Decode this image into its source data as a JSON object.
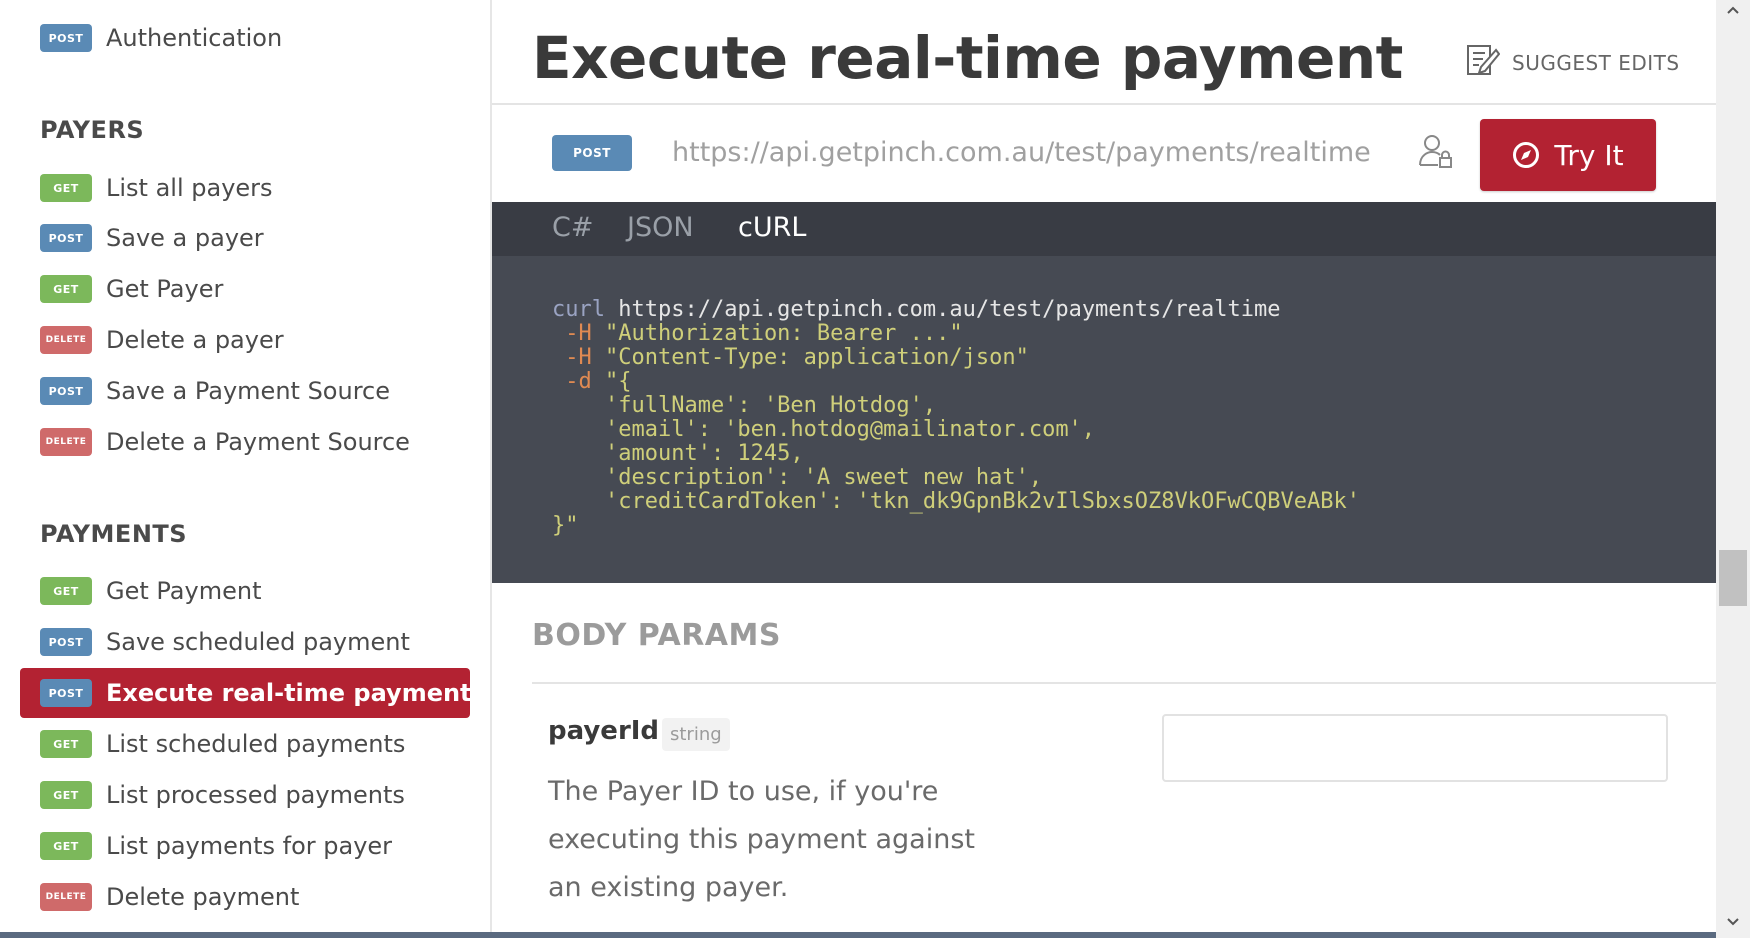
{
  "sidebar": {
    "auth_item": {
      "method": "POST",
      "label": "Authentication"
    },
    "sections": [
      {
        "title": "PAYERS",
        "items": [
          {
            "method": "GET",
            "label": "List all payers"
          },
          {
            "method": "POST",
            "label": "Save a payer"
          },
          {
            "method": "GET",
            "label": "Get Payer"
          },
          {
            "method": "DELETE",
            "label": "Delete a payer"
          },
          {
            "method": "POST",
            "label": "Save a Payment Source"
          },
          {
            "method": "DELETE",
            "label": "Delete a Payment Source"
          }
        ]
      },
      {
        "title": "PAYMENTS",
        "items": [
          {
            "method": "GET",
            "label": "Get Payment"
          },
          {
            "method": "POST",
            "label": "Save scheduled payment"
          },
          {
            "method": "POST",
            "label": "Execute real-time payment",
            "active": true
          },
          {
            "method": "GET",
            "label": "List scheduled payments"
          },
          {
            "method": "GET",
            "label": "List processed payments"
          },
          {
            "method": "GET",
            "label": "List payments for payer"
          },
          {
            "method": "DELETE",
            "label": "Delete payment"
          }
        ]
      }
    ]
  },
  "main": {
    "title": "Execute real-time payment",
    "suggest_edits": "SUGGEST EDITS",
    "endpoint": {
      "method": "POST",
      "url": "https://api.getpinch.com.au/test/payments/realtime",
      "try_it": "Try It"
    },
    "code_tabs": [
      "C#",
      "JSON",
      "cURL"
    ],
    "active_code_tab": "cURL",
    "code": {
      "cmd": "curl",
      "url": "https://api.getpinch.com.au/test/payments/realtime",
      "header1_flag": "-H",
      "header1": "\"Authorization: Bearer ...\"",
      "header2_flag": "-H",
      "header2": "\"Content-Type: application/json\"",
      "data_flag": "-d",
      "body_lines": [
        "\"{",
        "    'fullName': 'Ben Hotdog',",
        "    'email': 'ben.hotdog@mailinator.com',",
        "    'amount': 1245,",
        "    'description': 'A sweet new hat',",
        "    'creditCardToken': 'tkn_dk9GpnBk2vIlSbxsOZ8VkOFwCQBVeABk'",
        "}\""
      ]
    },
    "body_params_title": "BODY PARAMS",
    "params": [
      {
        "name": "payerId",
        "type": "string",
        "description": "The Payer ID to use, if you're executing this payment against an existing payer.",
        "value": ""
      }
    ]
  },
  "colors": {
    "brand_red": "#b32232",
    "post": "#5a8ab5",
    "get": "#7cb85b",
    "delete": "#cf6a6a",
    "code_bg": "#464a53"
  }
}
